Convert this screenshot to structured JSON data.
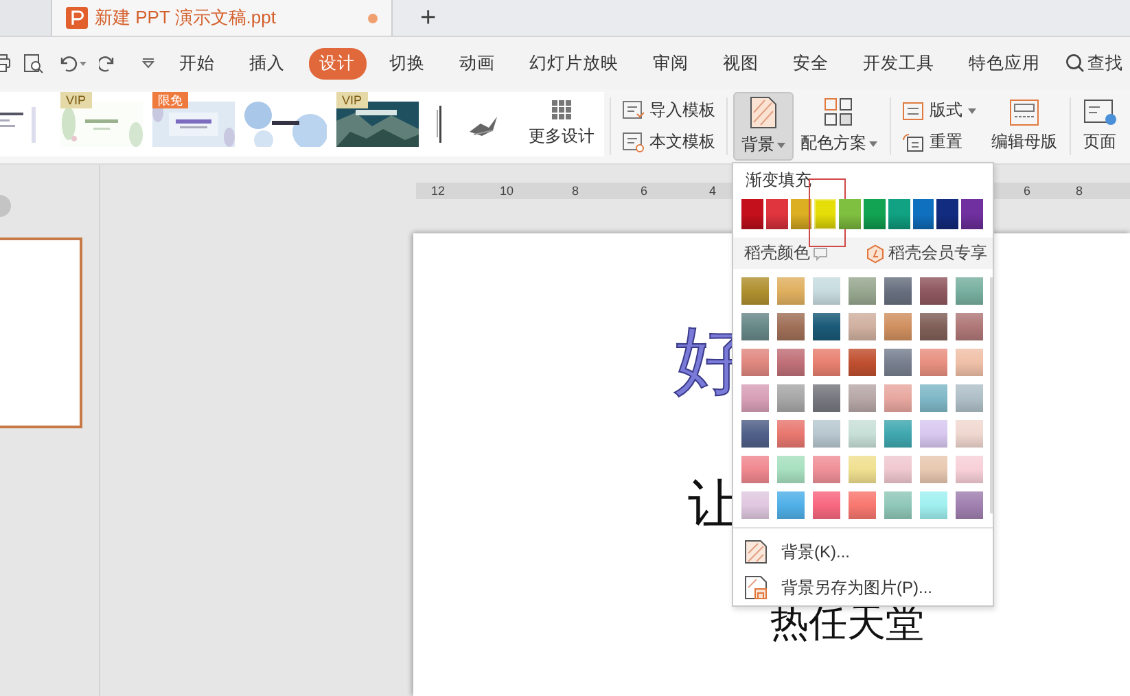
{
  "document_tabs": [
    {
      "title": "新建 PPT 演示文稿.ppt",
      "selected": true,
      "unsaved": true
    }
  ],
  "new_tab": "+",
  "menu_tabs": [
    {
      "label": "开始",
      "selected": false
    },
    {
      "label": "插入",
      "selected": false
    },
    {
      "label": "设计",
      "selected": true
    },
    {
      "label": "切换",
      "selected": false
    },
    {
      "label": "动画",
      "selected": false
    },
    {
      "label": "幻灯片放映",
      "selected": false
    },
    {
      "label": "审阅",
      "selected": false
    },
    {
      "label": "视图",
      "selected": false
    },
    {
      "label": "安全",
      "selected": false
    },
    {
      "label": "开发工具",
      "selected": false
    },
    {
      "label": "特色应用",
      "selected": false
    }
  ],
  "search": {
    "label": "查找"
  },
  "ribbon": {
    "templates": [
      {
        "kind": "picture"
      },
      {
        "kind": "picture",
        "badge": {
          "text": "VIP",
          "color": "#e6d9a8"
        }
      },
      {
        "kind": "picture",
        "badge": {
          "text": "限免",
          "color": "#ef7a3e"
        }
      },
      {
        "kind": "picture"
      },
      {
        "kind": "picture",
        "badge": {
          "text": "VIP",
          "color": "#e6d9a8"
        }
      },
      {
        "kind": "picture"
      }
    ],
    "more_designs": "更多设计",
    "import_template": "导入模板",
    "text_template": "本文模板",
    "background": {
      "label": "背景",
      "pressed": true
    },
    "color_scheme": "配色方案",
    "layout": "版式",
    "reset": "重置",
    "edit_master": "编辑母版",
    "page_setup": "页面"
  },
  "ruler": {
    "left_labels": [
      "12",
      "10",
      "8",
      "6",
      "4"
    ],
    "right_labels": [
      "6",
      "8"
    ]
  },
  "slide": {
    "title": "好",
    "subtitle": "让",
    "body": "热任天堂"
  },
  "background_menu": {
    "gradient_header": "渐变填充",
    "gradients": [
      {
        "color": "#c4101c",
        "selected": false
      },
      {
        "color": "#e0343e",
        "selected": false
      },
      {
        "color": "#dcae22",
        "selected": false
      },
      {
        "color": "#e6de08",
        "selected": true
      },
      {
        "color": "#80c040",
        "selected": false
      },
      {
        "color": "#12a452",
        "selected": false
      },
      {
        "color": "#10a282",
        "selected": false
      },
      {
        "color": "#1070c0",
        "selected": false
      },
      {
        "color": "#122c80",
        "selected": false
      },
      {
        "color": "#7030a0",
        "selected": false
      }
    ],
    "docer_header": "稻壳颜色",
    "member_label": "稻壳会员专享",
    "swatches": [
      {
        "color": "#b09030"
      },
      {
        "color": "#e0b060"
      },
      {
        "color": "#c8dce0"
      },
      {
        "color": "#98a890"
      },
      {
        "color": "#687080"
      },
      {
        "color": "#905860"
      },
      {
        "color": "#78b0a0"
      },
      {
        "color": "#688888"
      },
      {
        "color": "#a07058"
      },
      {
        "color": "#1a5a78"
      },
      {
        "color": "#d0b0a0"
      },
      {
        "color": "#d09060"
      },
      {
        "color": "#806058"
      },
      {
        "color": "#b07878"
      },
      {
        "color": "#e08880"
      },
      {
        "color": "#c07078"
      },
      {
        "color": "#e88070"
      },
      {
        "color": "#c05030"
      },
      {
        "color": "#788090"
      },
      {
        "color": "#e89080"
      },
      {
        "color": "#f0c0a8"
      },
      {
        "color": "#d8a0b8"
      },
      {
        "color": "#a8a8a8"
      },
      {
        "color": "#787880"
      },
      {
        "color": "#b8a8a8"
      },
      {
        "color": "#e8a8a0"
      },
      {
        "color": "#80b8c8"
      },
      {
        "color": "#b0c0c8"
      },
      {
        "color": "#506088"
      },
      {
        "color": "#e87870"
      },
      {
        "color": "#b8c8d0"
      },
      {
        "color": "#c8e0d8"
      },
      {
        "color": "#40a8b0"
      },
      {
        "color": "#d8c8f0"
      },
      {
        "color": "#f0d8d0"
      },
      {
        "color": "#f08890"
      },
      {
        "color": "#a8e0c0"
      },
      {
        "color": "#f09098"
      },
      {
        "color": "#f0e090"
      },
      {
        "color": "#f0c8d0"
      },
      {
        "color": "#e8c8b0"
      },
      {
        "color": "#f8d0d8"
      },
      {
        "color": "#e0c8e0"
      },
      {
        "color": "#50b0e8"
      },
      {
        "color": "#f86880"
      },
      {
        "color": "#f87870"
      },
      {
        "color": "#90c8b8"
      },
      {
        "color": "#a0f0f0"
      },
      {
        "color": "#a080b0"
      }
    ],
    "items": [
      {
        "label": "背景(K)...",
        "kind": "background"
      },
      {
        "label": "背景另存为图片(P)...",
        "kind": "save_image"
      }
    ]
  }
}
